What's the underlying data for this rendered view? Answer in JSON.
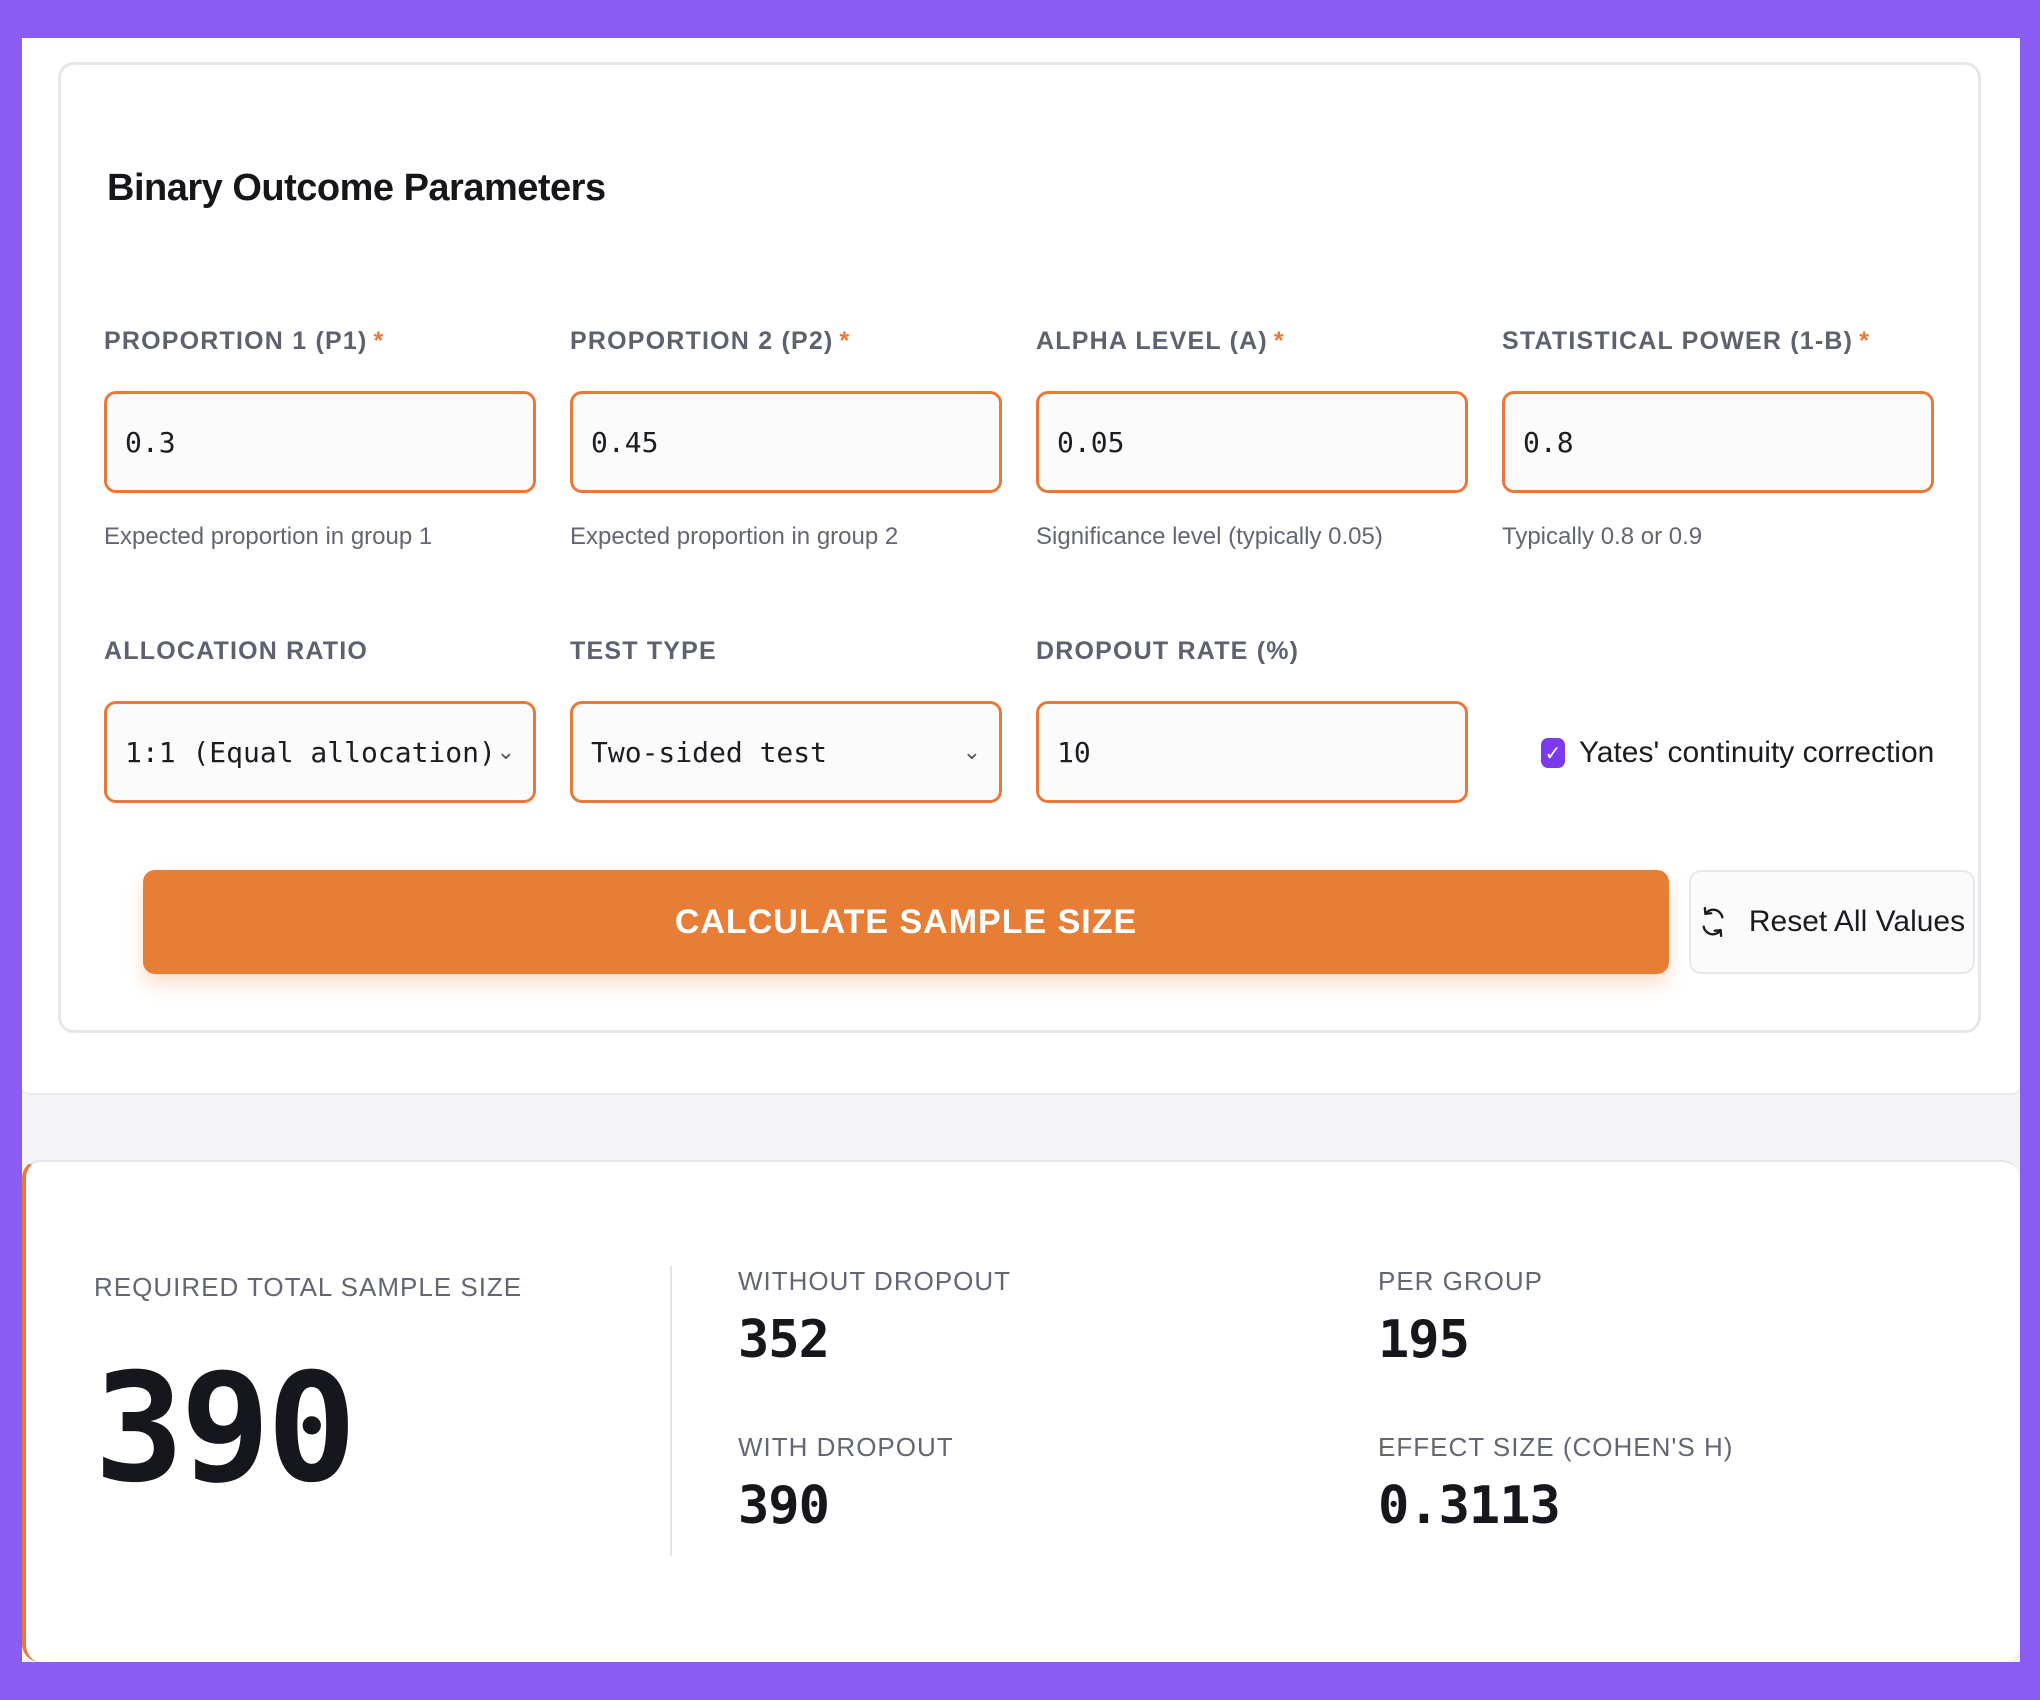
{
  "section": {
    "title": "Binary Outcome Parameters"
  },
  "fields": {
    "p1": {
      "label": "PROPORTION 1 (P1)",
      "value": "0.3",
      "help": "Expected proportion in group 1",
      "required": "*"
    },
    "p2": {
      "label": "PROPORTION 2 (P2)",
      "value": "0.45",
      "help": "Expected proportion in group 2",
      "required": "*"
    },
    "alpha": {
      "label": "ALPHA LEVEL (α)",
      "value": "0.05",
      "help": "Significance level (typically 0.05)",
      "required": "*"
    },
    "power": {
      "label": "STATISTICAL POWER (1-β)",
      "value": "0.8",
      "help": "Typically 0.8 or 0.9",
      "required": "*"
    },
    "allocation": {
      "label": "ALLOCATION RATIO",
      "value": "1:1 (Equal allocation)"
    },
    "test_type": {
      "label": "TEST TYPE",
      "value": "Two-sided test"
    },
    "dropout": {
      "label": "DROPOUT RATE (%)",
      "value": "10"
    }
  },
  "yates": {
    "label": "Yates' continuity correction",
    "checked": true
  },
  "buttons": {
    "calculate": "CALCULATE SAMPLE SIZE",
    "reset": "Reset All Values"
  },
  "results": {
    "total_label": "REQUIRED TOTAL SAMPLE SIZE",
    "total_value": "390",
    "without_dropout_label": "WITHOUT DROPOUT",
    "without_dropout_value": "352",
    "per_group_label": "PER GROUP",
    "per_group_value": "195",
    "with_dropout_label": "WITH DROPOUT",
    "with_dropout_value": "390",
    "effect_size_label": "EFFECT SIZE (COHEN'S H)",
    "effect_size_value": "0.3113"
  },
  "colors": {
    "accent": "#e8793a",
    "background": "#8b5cf2",
    "checkbox": "#7c3aed"
  }
}
